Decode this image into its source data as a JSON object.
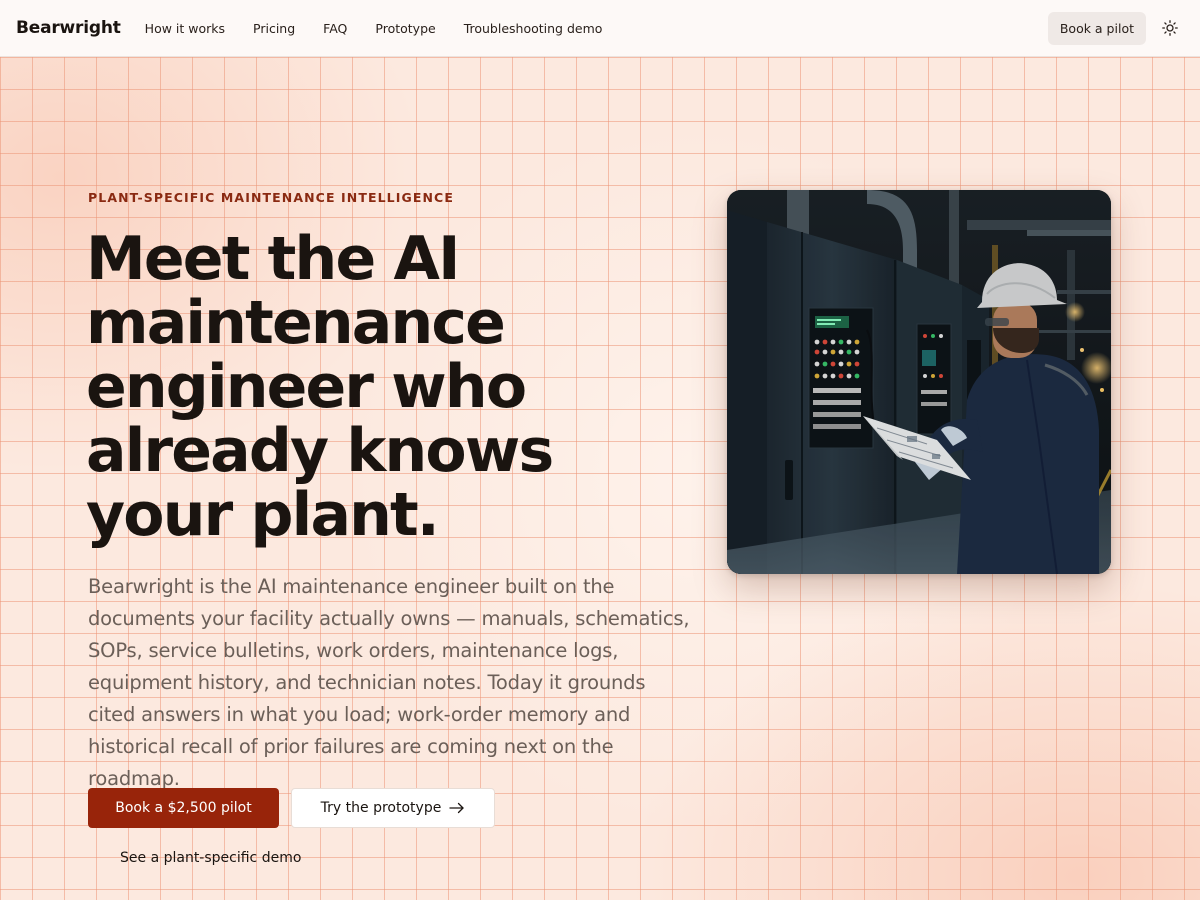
{
  "header": {
    "brand": "Bearwright",
    "nav": [
      {
        "label": "How it works"
      },
      {
        "label": "Pricing"
      },
      {
        "label": "FAQ"
      },
      {
        "label": "Prototype"
      },
      {
        "label": "Troubleshooting demo"
      }
    ],
    "cta_label": "Book a pilot",
    "theme_icon": "sun-icon"
  },
  "hero": {
    "eyebrow": "PLANT-SPECIFIC MAINTENANCE INTELLIGENCE",
    "headline": "Meet the AI maintenance engineer who already knows your plant.",
    "lede": "Bearwright is the AI maintenance engineer built on the documents your facility actually owns — manuals, schematics, SOPs, service bulletins, work orders, maintenance logs, equipment history, and technician notes. Today it grounds cited answers in what you load; work-order memory and historical recall of prior failures are coming next on the roadmap.",
    "primary_cta": "Book a $2,500 pilot",
    "secondary_cta": "Try the prototype",
    "secondary_cta_icon": "arrow-right-icon",
    "demo_link": "See a plant-specific demo",
    "image_subject": "maintenance-technician-at-control-panel"
  },
  "colors": {
    "accent": "#98240a",
    "eyebrow": "#8a2a12",
    "grid_line": "#ec9678",
    "background": "#fce9df"
  }
}
